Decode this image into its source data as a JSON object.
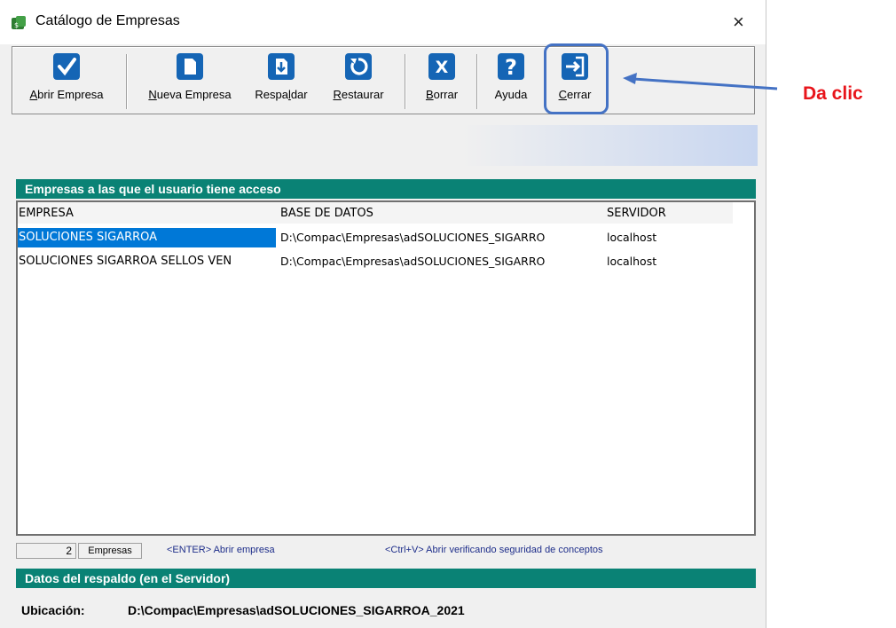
{
  "window": {
    "title": "Catálogo de Empresas",
    "close_glyph": "×"
  },
  "toolbar": {
    "abrir": {
      "label_u": "A",
      "label_rest": "brir Empresa",
      "icon": "checkmark-icon"
    },
    "nueva": {
      "label_u": "N",
      "label_rest": "ueva Empresa",
      "icon": "new-document-icon"
    },
    "respaldar": {
      "label_pre": "Respa",
      "label_u": "l",
      "label_rest": "dar",
      "icon": "backup-icon"
    },
    "restaurar": {
      "label_u": "R",
      "label_rest": "estaurar",
      "icon": "restore-icon"
    },
    "borrar": {
      "label_u": "B",
      "label_rest": "orrar",
      "icon": "delete-x-icon"
    },
    "ayuda": {
      "label": "Ayuda",
      "icon": "help-question-icon"
    },
    "cerrar": {
      "label_u": "C",
      "label_rest": "errar",
      "icon": "exit-door-icon"
    }
  },
  "companies_section": {
    "header": "Empresas a las que el usuario tiene acceso",
    "columns": [
      "EMPRESA",
      "BASE DE DATOS",
      "SERVIDOR"
    ],
    "rows": [
      {
        "empresa": "SOLUCIONES SIGARROA",
        "base": "D:\\Compac\\Empresas\\adSOLUCIONES_SIGARRO",
        "servidor": "localhost",
        "selected": true
      },
      {
        "empresa": "SOLUCIONES SIGARROA SELLOS VEN",
        "base": "D:\\Compac\\Empresas\\adSOLUCIONES_SIGARRO",
        "servidor": "localhost",
        "selected": false
      }
    ]
  },
  "status": {
    "count": "2",
    "count_label": "Empresas",
    "hint_enter": "<ENTER> Abrir empresa",
    "hint_ctrlv": "<Ctrl+V>  Abrir verificando seguridad de conceptos"
  },
  "backup_section": {
    "header": "Datos del respaldo (en el Servidor)",
    "location_label": "Ubicación:",
    "location_value": "D:\\Compac\\Empresas\\adSOLUCIONES_SIGARROA_2021"
  },
  "annotation": {
    "text": "Da clic",
    "color": "#e8151b",
    "arrow_color": "#4472c4"
  },
  "colors": {
    "accent_green": "#0a8275",
    "selection_blue": "#0078d7",
    "icon_blue": "#1565b5"
  }
}
